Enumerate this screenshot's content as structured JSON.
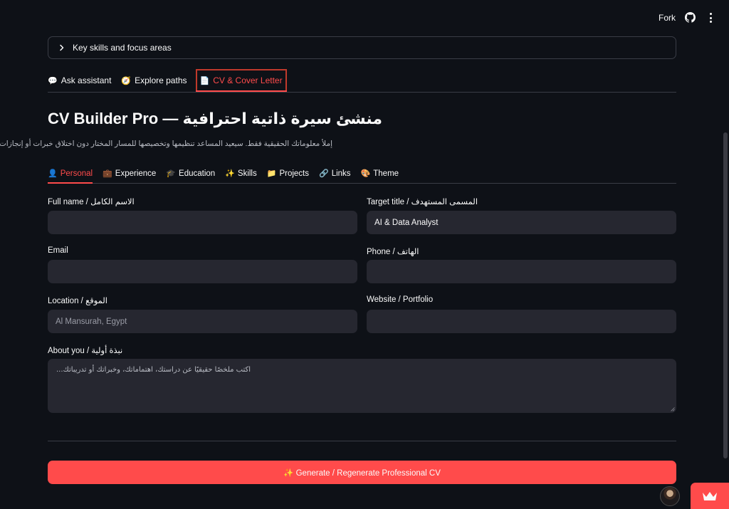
{
  "header": {
    "fork_label": "Fork"
  },
  "expander": {
    "label": "Key skills and focus areas"
  },
  "main_tabs": [
    {
      "icon": "💬",
      "label": "Ask assistant",
      "active": false
    },
    {
      "icon": "🧭",
      "label": "Explore paths",
      "active": false
    },
    {
      "icon": "📄",
      "label": "CV & Cover Letter",
      "active": true
    }
  ],
  "page": {
    "title": "CV Builder Pro — منشئ سيرة ذاتية احترافية",
    "subtitle": "إملأ معلوماتك الحقيقية فقط. سيعيد المساعد تنظيمها وتخصيصها للمسار المختار دون اختلاق خبرات أو إنجازات."
  },
  "inner_tabs": [
    {
      "icon": "👤",
      "label": "Personal",
      "active": true
    },
    {
      "icon": "💼",
      "label": "Experience",
      "active": false
    },
    {
      "icon": "🎓",
      "label": "Education",
      "active": false
    },
    {
      "icon": "✨",
      "label": "Skills",
      "active": false
    },
    {
      "icon": "📁",
      "label": "Projects",
      "active": false
    },
    {
      "icon": "🔗",
      "label": "Links",
      "active": false
    },
    {
      "icon": "🎨",
      "label": "Theme",
      "active": false
    }
  ],
  "form": {
    "full_name": {
      "label": "Full name / الاسم الكامل",
      "value": "",
      "placeholder": ""
    },
    "target_title": {
      "label": "Target title / المسمى المستهدف",
      "value": "AI & Data Analyst",
      "placeholder": ""
    },
    "email": {
      "label": "Email",
      "value": "",
      "placeholder": ""
    },
    "phone": {
      "label": "Phone / الهاتف",
      "value": "",
      "placeholder": ""
    },
    "location": {
      "label": "Location / الموقع",
      "value": "",
      "placeholder": "Al Mansurah, Egypt"
    },
    "website": {
      "label": "Website / Portfolio",
      "value": "",
      "placeholder": ""
    },
    "about": {
      "label": "About you / نبذة أولية",
      "value": "",
      "placeholder": "اكتب ملخصًا حقيقيًا عن دراستك، اهتماماتك، وخبراتك أو تدريباتك..."
    }
  },
  "generate_button": {
    "label": "✨ Generate / Regenerate Professional CV"
  },
  "colors": {
    "background": "#0e1117",
    "accent": "#ff4b4b",
    "input_bg": "#262730"
  }
}
